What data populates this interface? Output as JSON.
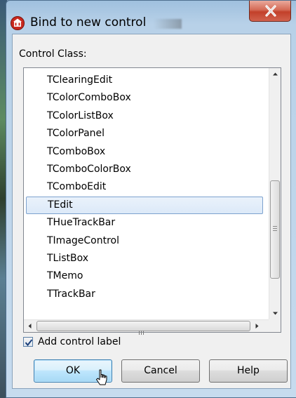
{
  "window": {
    "title": "Bind to new control"
  },
  "form": {
    "control_class_label": "Control Class:",
    "items": [
      "TClearingEdit",
      "TColorComboBox",
      "TColorListBox",
      "TColorPanel",
      "TComboBox",
      "TComboColorBox",
      "TComboEdit",
      "TEdit",
      "THueTrackBar",
      "TImageControl",
      "TListBox",
      "TMemo",
      "TTrackBar"
    ],
    "selected_item": "TEdit",
    "add_label_checkbox": {
      "label": "Add control label",
      "checked": true
    }
  },
  "buttons": {
    "ok": "OK",
    "cancel": "Cancel",
    "help": "Help"
  },
  "icons": {
    "app": "app-icon",
    "close": "close-icon",
    "scroll_up": "triangle-up-icon",
    "scroll_down": "triangle-down-icon",
    "scroll_left": "triangle-left-icon",
    "scroll_right": "triangle-right-icon",
    "cursor": "mouse-pointer-icon"
  }
}
